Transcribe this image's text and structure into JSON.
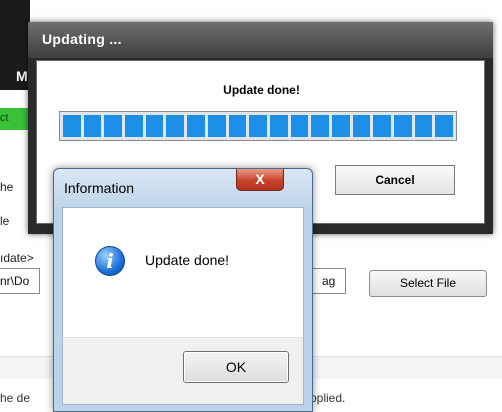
{
  "background": {
    "header_letter": "M",
    "green_tab_text": "ct",
    "text_line_1": "he",
    "text_line_2": "le",
    "path_label": "ıdate>",
    "path_value": "nr\\Do",
    "field_right_value": "ag",
    "select_file_label": "Select File",
    "footer_text_left": "he de",
    "footer_text_right": "pplied."
  },
  "updating_dialog": {
    "title": "Updating ...",
    "status": "Update done!",
    "progress": 1.0,
    "cancel_label": "Cancel"
  },
  "info_dialog": {
    "title": "Information",
    "close_glyph": "X",
    "icon_glyph": "i",
    "message": "Update done!",
    "ok_label": "OK"
  },
  "colors": {
    "progress_fill": "#1e8fe6",
    "green_tab": "#39c13a",
    "close_red": "#c7442a"
  },
  "icons": [
    "information-icon",
    "close-icon"
  ]
}
